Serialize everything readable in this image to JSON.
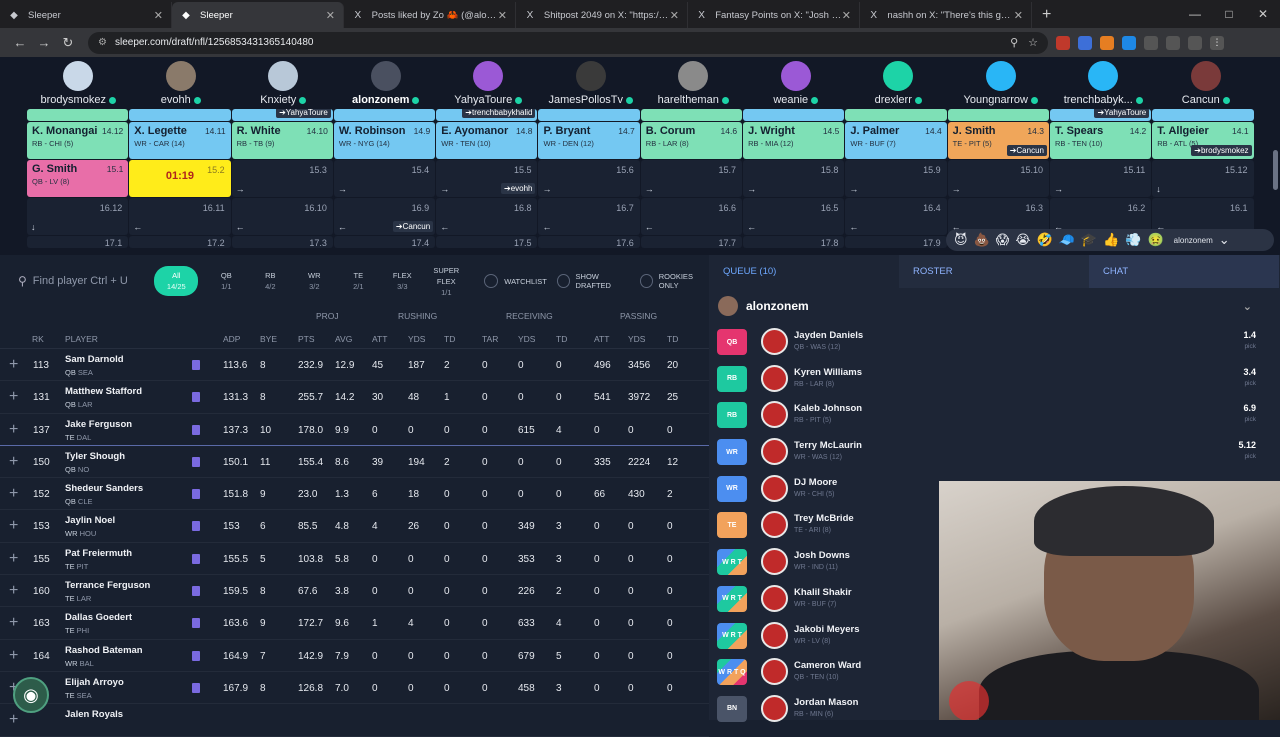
{
  "browser": {
    "tabs": [
      {
        "title": "Sleeper",
        "icon": "sleeper-icon",
        "active": false
      },
      {
        "title": "Sleeper",
        "icon": "sleeper-icon",
        "active": true
      },
      {
        "title": "Posts liked by Zo 🦀 (@alonzo",
        "icon": "x-icon",
        "active": false
      },
      {
        "title": "Shitpost 2049 on X: \"https://t.c",
        "icon": "x-icon",
        "active": false
      },
      {
        "title": "Fantasy Points on X: \"Josh Dow",
        "icon": "x-icon",
        "active": false
      },
      {
        "title": "nashh on X: \"There's this guy w",
        "icon": "x-icon",
        "active": false
      }
    ],
    "url": "sleeper.com/draft/nfl/1256853431365140480"
  },
  "managers": [
    {
      "name": "brodysmokez",
      "color": "#c9d8e8",
      "me": false
    },
    {
      "name": "evohh",
      "color": "#8a7a6a",
      "me": false
    },
    {
      "name": "Knxiety",
      "color": "#b8c8d8",
      "me": false
    },
    {
      "name": "alonzonem",
      "color": "#4a5060",
      "me": true
    },
    {
      "name": "YahyaToure",
      "color": "#9b59d6",
      "me": false
    },
    {
      "name": "JamesPollosTv",
      "color": "#3a3a3a",
      "me": false
    },
    {
      "name": "hareltheman",
      "color": "#8a8a8a",
      "me": false
    },
    {
      "name": "weanie",
      "color": "#9b59d6",
      "me": false
    },
    {
      "name": "drexlerr",
      "color": "#1dd3a7",
      "me": false
    },
    {
      "name": "Youngnarrow",
      "color": "#29b6f6",
      "me": false
    },
    {
      "name": "trenchbabyk...",
      "color": "#29b6f6",
      "me": false
    },
    {
      "name": "Cancun",
      "color": "#7a3a3a",
      "me": false
    }
  ],
  "board": {
    "row13_partial": [
      {
        "pos": "RB",
        "tag": ""
      },
      {
        "pos": "WR",
        "tag": ""
      },
      {
        "pos": "WR",
        "tag": "YahyaToure"
      },
      {
        "pos": "WR",
        "tag": ""
      },
      {
        "pos": "WR",
        "tag": "trenchbabykhalid"
      },
      {
        "pos": "WR",
        "tag": ""
      },
      {
        "pos": "RB",
        "tag": ""
      },
      {
        "pos": "WR",
        "tag": ""
      },
      {
        "pos": "RB",
        "tag": ""
      },
      {
        "pos": "RB",
        "tag": ""
      },
      {
        "pos": "WR",
        "tag": "YahyaToure"
      },
      {
        "pos": "WR",
        "tag": ""
      }
    ],
    "row14": [
      {
        "name": "K. Monangai",
        "num": "14.12",
        "info": "RB - CHI (5)",
        "pos": "RB",
        "tag": ""
      },
      {
        "name": "X. Legette",
        "num": "14.11",
        "info": "WR - CAR (14)",
        "pos": "WR",
        "tag": ""
      },
      {
        "name": "R. White",
        "num": "14.10",
        "info": "RB - TB (9)",
        "pos": "RB",
        "tag": ""
      },
      {
        "name": "W. Robinson",
        "num": "14.9",
        "info": "WR - NYG (14)",
        "pos": "WR",
        "tag": ""
      },
      {
        "name": "E. Ayomanor",
        "num": "14.8",
        "info": "WR - TEN (10)",
        "pos": "WR",
        "tag": ""
      },
      {
        "name": "P. Bryant",
        "num": "14.7",
        "info": "WR - DEN (12)",
        "pos": "WR",
        "tag": ""
      },
      {
        "name": "B. Corum",
        "num": "14.6",
        "info": "RB - LAR (8)",
        "pos": "RB",
        "tag": ""
      },
      {
        "name": "J. Wright",
        "num": "14.5",
        "info": "RB - MIA (12)",
        "pos": "RB",
        "tag": ""
      },
      {
        "name": "J. Palmer",
        "num": "14.4",
        "info": "WR - BUF (7)",
        "pos": "WR",
        "tag": ""
      },
      {
        "name": "J. Smith",
        "num": "14.3",
        "info": "TE - PIT (5)",
        "pos": "TE",
        "tag": "Cancun"
      },
      {
        "name": "T. Spears",
        "num": "14.2",
        "info": "RB - TEN (10)",
        "pos": "RB",
        "tag": ""
      },
      {
        "name": "T. Allgeier",
        "num": "14.1",
        "info": "RB - ATL (5)",
        "pos": "RB",
        "tag": "brodysmokez"
      }
    ],
    "row15": [
      {
        "name": "G. Smith",
        "num": "15.1",
        "info": "QB - LV (8)",
        "pos": "QB",
        "tag": "",
        "empty": false
      },
      {
        "timer": "01:19",
        "num": "15.2"
      },
      {
        "num": "15.3",
        "arrow": "→"
      },
      {
        "num": "15.4",
        "arrow": "→"
      },
      {
        "num": "15.5",
        "arrow": "→",
        "tag": "evohh"
      },
      {
        "num": "15.6",
        "arrow": "→"
      },
      {
        "num": "15.7",
        "arrow": "→"
      },
      {
        "num": "15.8",
        "arrow": "→"
      },
      {
        "num": "15.9",
        "arrow": "→"
      },
      {
        "num": "15.10",
        "arrow": "→"
      },
      {
        "num": "15.11",
        "arrow": "→"
      },
      {
        "num": "15.12",
        "arrow": "↓"
      }
    ],
    "row16": [
      {
        "num": "16.12",
        "arrow": "↓"
      },
      {
        "num": "16.11",
        "arrow": "←"
      },
      {
        "num": "16.10",
        "arrow": "←"
      },
      {
        "num": "16.9",
        "arrow": "←",
        "tag": "Cancun"
      },
      {
        "num": "16.8",
        "arrow": "←"
      },
      {
        "num": "16.7",
        "arrow": "←"
      },
      {
        "num": "16.6",
        "arrow": "←"
      },
      {
        "num": "16.5",
        "arrow": "←"
      },
      {
        "num": "16.4",
        "arrow": "←"
      },
      {
        "num": "16.3",
        "arrow": "←"
      },
      {
        "num": "16.2",
        "arrow": "←"
      },
      {
        "num": "16.1",
        "arrow": "←"
      }
    ],
    "row17": [
      "17.1",
      "17.2",
      "17.3",
      "17.4",
      "17.5",
      "17.6",
      "17.7",
      "17.8",
      "17.9",
      "17.10",
      "17.11",
      "17.12"
    ],
    "emoji_user": "alonzonem"
  },
  "filters": {
    "search_placeholder": "Find player Ctrl + U",
    "tabs": [
      {
        "label": "All",
        "count": "14/25",
        "active": true
      },
      {
        "label": "QB",
        "count": "1/1",
        "active": false
      },
      {
        "label": "RB",
        "count": "4/2",
        "active": false
      },
      {
        "label": "WR",
        "count": "3/2",
        "active": false
      },
      {
        "label": "TE",
        "count": "2/1",
        "active": false
      },
      {
        "label": "FLEX",
        "count": "3/3",
        "active": false
      },
      {
        "label": "SUPER FLEX",
        "count": "1/1",
        "active": false
      }
    ],
    "toggles": [
      "WATCHLIST",
      "SHOW DRAFTED",
      "ROOKIES ONLY"
    ]
  },
  "table": {
    "groups": [
      "PROJ",
      "RUSHING",
      "RECEIVING",
      "PASSING"
    ],
    "headers": [
      "RK",
      "PLAYER",
      "ADP",
      "BYE",
      "PTS",
      "AVG",
      "ATT",
      "YDS",
      "TD",
      "TAR",
      "YDS",
      "TD",
      "ATT",
      "YDS",
      "TD"
    ],
    "rows": [
      {
        "rk": "113",
        "name": "Sam Darnold",
        "pos": "QB",
        "team": "SEA",
        "adp": "113.6",
        "bye": "8",
        "pts": "232.9",
        "avg": "12.9",
        "ratt": "45",
        "ryds": "187",
        "rtd": "2",
        "tar": "0",
        "cyds": "0",
        "ctd": "0",
        "patt": "496",
        "pyds": "3456",
        "ptd": "20"
      },
      {
        "rk": "131",
        "name": "Matthew Stafford",
        "pos": "QB",
        "team": "LAR",
        "adp": "131.3",
        "bye": "8",
        "pts": "255.7",
        "avg": "14.2",
        "ratt": "30",
        "ryds": "48",
        "rtd": "1",
        "tar": "0",
        "cyds": "0",
        "ctd": "0",
        "patt": "541",
        "pyds": "3972",
        "ptd": "25"
      },
      {
        "rk": "137",
        "name": "Jake Ferguson",
        "pos": "TE",
        "team": "DAL",
        "adp": "137.3",
        "bye": "10",
        "pts": "178.0",
        "avg": "9.9",
        "ratt": "0",
        "ryds": "0",
        "rtd": "0",
        "tar": "0",
        "cyds": "615",
        "ctd": "4",
        "patt": "0",
        "pyds": "0",
        "ptd": "0"
      },
      {
        "rk": "150",
        "name": "Tyler Shough",
        "pos": "QB",
        "team": "NO",
        "adp": "150.1",
        "bye": "11",
        "pts": "155.4",
        "avg": "8.6",
        "ratt": "39",
        "ryds": "194",
        "rtd": "2",
        "tar": "0",
        "cyds": "0",
        "ctd": "0",
        "patt": "335",
        "pyds": "2224",
        "ptd": "12"
      },
      {
        "rk": "152",
        "name": "Shedeur Sanders",
        "pos": "QB",
        "team": "CLE",
        "adp": "151.8",
        "bye": "9",
        "pts": "23.0",
        "avg": "1.3",
        "ratt": "6",
        "ryds": "18",
        "rtd": "0",
        "tar": "0",
        "cyds": "0",
        "ctd": "0",
        "patt": "66",
        "pyds": "430",
        "ptd": "2"
      },
      {
        "rk": "153",
        "name": "Jaylin Noel",
        "pos": "WR",
        "team": "HOU",
        "adp": "153",
        "bye": "6",
        "pts": "85.5",
        "avg": "4.8",
        "ratt": "4",
        "ryds": "26",
        "rtd": "0",
        "tar": "0",
        "cyds": "349",
        "ctd": "3",
        "patt": "0",
        "pyds": "0",
        "ptd": "0"
      },
      {
        "rk": "155",
        "name": "Pat Freiermuth",
        "pos": "TE",
        "team": "PIT",
        "adp": "155.5",
        "bye": "5",
        "pts": "103.8",
        "avg": "5.8",
        "ratt": "0",
        "ryds": "0",
        "rtd": "0",
        "tar": "0",
        "cyds": "353",
        "ctd": "3",
        "patt": "0",
        "pyds": "0",
        "ptd": "0"
      },
      {
        "rk": "160",
        "name": "Terrance Ferguson",
        "pos": "TE",
        "team": "LAR",
        "adp": "159.5",
        "bye": "8",
        "pts": "67.6",
        "avg": "3.8",
        "ratt": "0",
        "ryds": "0",
        "rtd": "0",
        "tar": "0",
        "cyds": "226",
        "ctd": "2",
        "patt": "0",
        "pyds": "0",
        "ptd": "0"
      },
      {
        "rk": "163",
        "name": "Dallas Goedert",
        "pos": "TE",
        "team": "PHI",
        "adp": "163.6",
        "bye": "9",
        "pts": "172.7",
        "avg": "9.6",
        "ratt": "1",
        "ryds": "4",
        "rtd": "0",
        "tar": "0",
        "cyds": "633",
        "ctd": "4",
        "patt": "0",
        "pyds": "0",
        "ptd": "0"
      },
      {
        "rk": "164",
        "name": "Rashod Bateman",
        "pos": "WR",
        "team": "BAL",
        "adp": "164.9",
        "bye": "7",
        "pts": "142.9",
        "avg": "7.9",
        "ratt": "0",
        "ryds": "0",
        "rtd": "0",
        "tar": "0",
        "cyds": "679",
        "ctd": "5",
        "patt": "0",
        "pyds": "0",
        "ptd": "0"
      },
      {
        "rk": "",
        "name": "Elijah Arroyo",
        "pos": "TE",
        "team": "SEA",
        "adp": "167.9",
        "bye": "8",
        "pts": "126.8",
        "avg": "7.0",
        "ratt": "0",
        "ryds": "0",
        "rtd": "0",
        "tar": "0",
        "cyds": "458",
        "ctd": "3",
        "patt": "0",
        "pyds": "0",
        "ptd": "0"
      },
      {
        "rk": "",
        "name": "Jalen Royals",
        "pos": "",
        "team": "",
        "adp": "",
        "bye": "",
        "pts": "",
        "avg": "",
        "ratt": "",
        "ryds": "",
        "rtd": "",
        "tar": "",
        "cyds": "",
        "ctd": "",
        "patt": "",
        "pyds": "",
        "ptd": ""
      }
    ]
  },
  "right": {
    "tabs": [
      "QUEUE (10)",
      "ROSTER",
      "CHAT"
    ],
    "user": "alonzonem",
    "roster": [
      {
        "slot": "QB",
        "cls": "QB",
        "name": "Jayden Daniels",
        "info": "QB - WAS (12)",
        "pick": "1.4"
      },
      {
        "slot": "RB",
        "cls": "RB",
        "name": "Kyren Williams",
        "info": "RB - LAR (8)",
        "pick": "3.4"
      },
      {
        "slot": "RB",
        "cls": "RB",
        "name": "Kaleb Johnson",
        "info": "RB - PIT (5)",
        "pick": "6.9"
      },
      {
        "slot": "WR",
        "cls": "WR",
        "name": "Terry McLaurin",
        "info": "WR - WAS (12)",
        "pick": "5.12"
      },
      {
        "slot": "WR",
        "cls": "WR",
        "name": "DJ Moore",
        "info": "WR - CHI (5)",
        "pick": ""
      },
      {
        "slot": "TE",
        "cls": "TE",
        "name": "Trey McBride",
        "info": "TE - ARI (8)",
        "pick": ""
      },
      {
        "slot": "W R T",
        "cls": "FLEX",
        "name": "Josh Downs",
        "info": "WR - IND (11)",
        "pick": ""
      },
      {
        "slot": "W R T",
        "cls": "FLEX",
        "name": "Khalil Shakir",
        "info": "WR - BUF (7)",
        "pick": ""
      },
      {
        "slot": "W R T",
        "cls": "FLEX",
        "name": "Jakobi Meyers",
        "info": "WR - LV (8)",
        "pick": ""
      },
      {
        "slot": "W R T Q",
        "cls": "SF",
        "name": "Cameron Ward",
        "info": "QB - TEN (10)",
        "pick": ""
      },
      {
        "slot": "BN",
        "cls": "BN",
        "name": "Jordan Mason",
        "info": "RB - MIN (6)",
        "pick": ""
      }
    ],
    "pick_label": "pick"
  }
}
